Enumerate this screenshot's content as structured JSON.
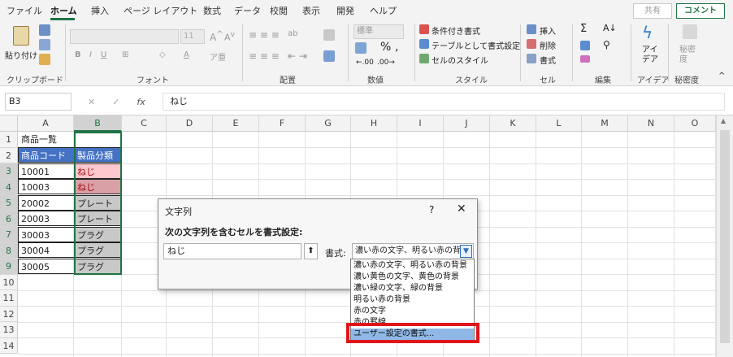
{
  "tabs": [
    "ファイル",
    "ホーム",
    "挿入",
    "ページ レイアウト",
    "数式",
    "データ",
    "校閲",
    "表示",
    "開発",
    "ヘルプ"
  ],
  "active_tab": "ホーム",
  "share_label": "共有",
  "comment_label": "コメント",
  "ribbon": {
    "clipboard": {
      "paste": "貼り付け",
      "label": "クリップボード"
    },
    "font": {
      "label": "フォント",
      "size": "11"
    },
    "alignment": {
      "label": "配置"
    },
    "number": {
      "label": "数値",
      "format": "標準"
    },
    "styles": {
      "label": "スタイル",
      "conditional": "条件付き書式",
      "table": "テーブルとして書式設定",
      "cell_styles": "セルのスタイル"
    },
    "cells": {
      "label": "セル",
      "insert": "挿入",
      "delete": "削除",
      "format": "書式"
    },
    "editing": {
      "label": "編集"
    },
    "ideas": {
      "label": "アイデア",
      "button": "アイ\nデア"
    },
    "sensitivity": {
      "label": "秘密度",
      "button": "秘密\n度"
    }
  },
  "formula_bar": {
    "name_box": "B3",
    "cancel": "✕",
    "enter": "✓",
    "fx": "fx",
    "content": "ねじ"
  },
  "columns": [
    "A",
    "B",
    "C",
    "D",
    "E",
    "F",
    "G",
    "H",
    "I",
    "J",
    "K",
    "L",
    "M",
    "N",
    "O"
  ],
  "rows": [
    "1",
    "2",
    "3",
    "4",
    "5",
    "6",
    "7",
    "8",
    "9",
    "10",
    "11",
    "12",
    "13",
    "14"
  ],
  "sheet": {
    "title": "商品一覧",
    "header": [
      "商品コード",
      "製品分類"
    ],
    "data": [
      [
        "10001",
        "ねじ"
      ],
      [
        "10003",
        "ねじ"
      ],
      [
        "20002",
        "プレート"
      ],
      [
        "20003",
        "プレート"
      ],
      [
        "30003",
        "プラグ"
      ],
      [
        "30004",
        "プラグ"
      ],
      [
        "30005",
        "プラグ"
      ]
    ]
  },
  "dialog": {
    "title": "文字列",
    "help": "?",
    "close": "✕",
    "instruction": "次の文字列を含むセルを書式設定:",
    "input_value": "ねじ",
    "format_label": "書式:",
    "selected_format": "濃い赤の文字、明るい赤の背景",
    "options": [
      "濃い赤の文字、明るい赤の背景",
      "濃い黄色の文字、黄色の背景",
      "濃い緑の文字、緑の背景",
      "明るい赤の背景",
      "赤の文字",
      "赤の罫線",
      "ユーザー設定の書式..."
    ]
  },
  "colors": {
    "accent": "#217346",
    "table_header": "#4472c4",
    "highlight": "#e0151b",
    "pink_fill": "#ffc7ce"
  }
}
